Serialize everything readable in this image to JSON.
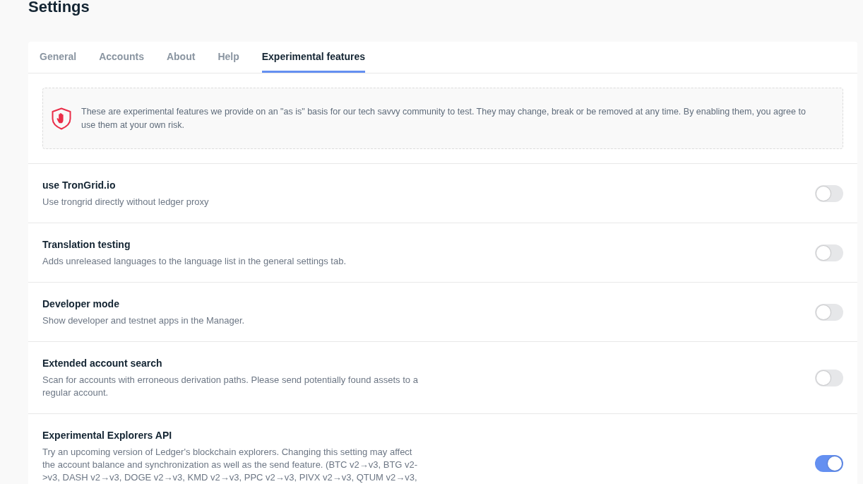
{
  "page": {
    "title": "Settings"
  },
  "tabs": [
    {
      "label": "General",
      "selected": false
    },
    {
      "label": "Accounts",
      "selected": false
    },
    {
      "label": "About",
      "selected": false
    },
    {
      "label": "Help",
      "selected": false
    },
    {
      "label": "Experimental features",
      "selected": true
    }
  ],
  "notice": {
    "text": "These are experimental features we provide on an \"as is\" basis for our tech savvy community to test. They may change, break or be removed at any time. By enabling them, you agree to use them at your own risk."
  },
  "features": [
    {
      "title": "use TronGrid.io",
      "description": "Use trongrid directly without ledger proxy",
      "on": false
    },
    {
      "title": "Translation testing",
      "description": "Adds unreleased languages to the language list in the general settings tab.",
      "on": false
    },
    {
      "title": "Developer mode",
      "description": "Show developer and testnet apps in the Manager.",
      "on": false
    },
    {
      "title": "Extended account search",
      "description": "Scan for accounts with erroneous derivation paths. Please send potentially found assets to a regular account.",
      "on": false
    },
    {
      "title": "Experimental Explorers API",
      "description": "Try an upcoming version of Ledger's blockchain explorers. Changing this setting may affect the account balance and synchronization as well as the send feature. (BTC v2→v3, BTG v2->v3, DASH v2→v3, DOGE v2→v3, KMD v2→v3, PPC v2→v3, PIVX v2→v3, QTUM v2→v3,",
      "on": true
    }
  ]
}
